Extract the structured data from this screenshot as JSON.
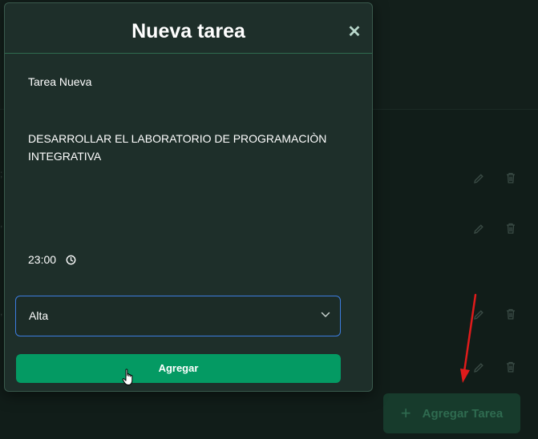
{
  "modal": {
    "title": "Nueva tarea",
    "close_glyph": "✕",
    "task_title": "Tarea Nueva",
    "task_description": "DESARROLLAR EL LABORATORIO DE PROGRAMACIÒN INTEGRATIVA",
    "task_time": "23:00",
    "priority_selected": "Alta",
    "submit_label": "Agregar"
  },
  "background": {
    "add_task_label": "Agregar Tarea",
    "add_task_glyph": "+"
  },
  "icons": {
    "close": "close-icon",
    "clock": "clock-icon",
    "chevron": "chevron-down-icon",
    "edit": "pencil-icon",
    "delete": "trash-icon",
    "cursor": "hand-pointer-icon",
    "annotation": "red-arrow-icon"
  },
  "colors": {
    "accent": "#049a63",
    "focus_border": "#3d7de0",
    "modal_bg": "#1e2f2a",
    "annotation": "#e01b1b"
  }
}
